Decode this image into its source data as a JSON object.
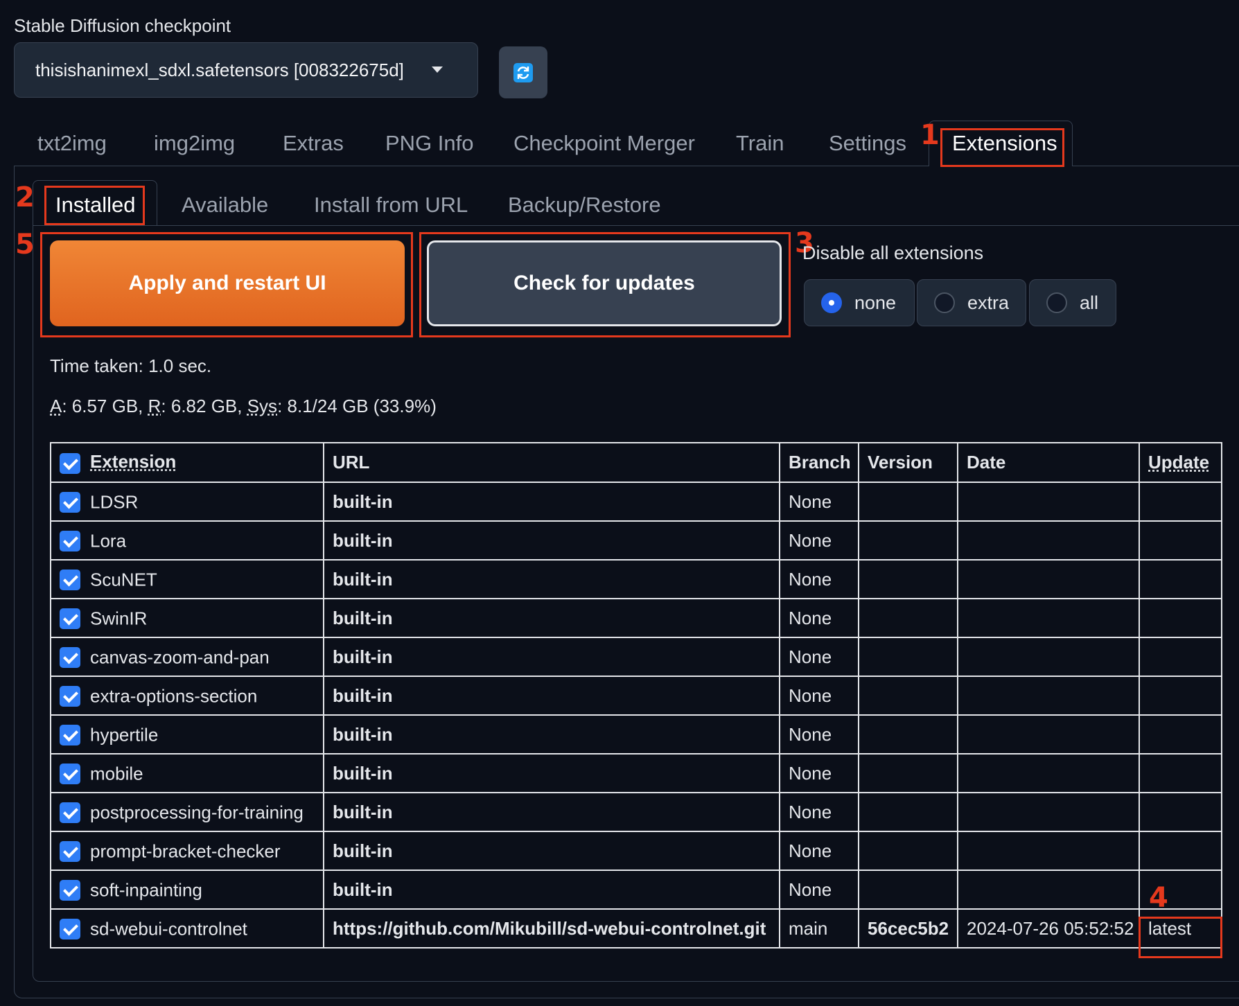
{
  "checkpoint": {
    "label": "Stable Diffusion checkpoint",
    "value": "thisishanimexl_sdxl.safetensors [008322675d]"
  },
  "main_tabs": [
    "txt2img",
    "img2img",
    "Extras",
    "PNG Info",
    "Checkpoint Merger",
    "Train",
    "Settings",
    "Extensions"
  ],
  "sub_tabs": [
    "Installed",
    "Available",
    "Install from URL",
    "Backup/Restore"
  ],
  "buttons": {
    "apply": "Apply and restart UI",
    "check": "Check for updates"
  },
  "disable": {
    "label": "Disable all extensions",
    "options": [
      "none",
      "extra",
      "all"
    ],
    "selected": "none"
  },
  "info": {
    "time_taken": "Time taken: 1.0 sec.",
    "mem_a_label": "A",
    "mem_a_value": ": 6.57 GB, ",
    "mem_r_label": "R",
    "mem_r_value": ": 6.82 GB, ",
    "mem_sys_label": "Sys",
    "mem_sys_value": ": 8.1/24 GB (33.9%)"
  },
  "annotations": [
    "1",
    "2",
    "3",
    "4",
    "5"
  ],
  "table": {
    "headers": [
      "Extension",
      "URL",
      "Branch",
      "Version",
      "Date",
      "Update"
    ],
    "rows": [
      {
        "name": "LDSR",
        "url": "built-in",
        "branch": "None",
        "version": "",
        "date": "",
        "update": ""
      },
      {
        "name": "Lora",
        "url": "built-in",
        "branch": "None",
        "version": "",
        "date": "",
        "update": ""
      },
      {
        "name": "ScuNET",
        "url": "built-in",
        "branch": "None",
        "version": "",
        "date": "",
        "update": ""
      },
      {
        "name": "SwinIR",
        "url": "built-in",
        "branch": "None",
        "version": "",
        "date": "",
        "update": ""
      },
      {
        "name": "canvas-zoom-and-pan",
        "url": "built-in",
        "branch": "None",
        "version": "",
        "date": "",
        "update": ""
      },
      {
        "name": "extra-options-section",
        "url": "built-in",
        "branch": "None",
        "version": "",
        "date": "",
        "update": ""
      },
      {
        "name": "hypertile",
        "url": "built-in",
        "branch": "None",
        "version": "",
        "date": "",
        "update": ""
      },
      {
        "name": "mobile",
        "url": "built-in",
        "branch": "None",
        "version": "",
        "date": "",
        "update": ""
      },
      {
        "name": "postprocessing-for-training",
        "url": "built-in",
        "branch": "None",
        "version": "",
        "date": "",
        "update": ""
      },
      {
        "name": "prompt-bracket-checker",
        "url": "built-in",
        "branch": "None",
        "version": "",
        "date": "",
        "update": ""
      },
      {
        "name": "soft-inpainting",
        "url": "built-in",
        "branch": "None",
        "version": "",
        "date": "",
        "update": ""
      },
      {
        "name": "sd-webui-controlnet",
        "url": "https://github.com/Mikubill/sd-webui-controlnet.git",
        "branch": "main",
        "version": "56cec5b2",
        "date": "2024-07-26 05:52:52",
        "update": "latest"
      }
    ]
  },
  "colors": {
    "background": "#0b0f19",
    "accent_orange": "#e8702a",
    "annotation_red": "#e5391d",
    "checkbox_blue": "#2f7df6"
  },
  "icons": {
    "refresh": "refresh-icon",
    "dropdown": "chevron-down-icon",
    "checkbox": "checkmark-icon"
  }
}
